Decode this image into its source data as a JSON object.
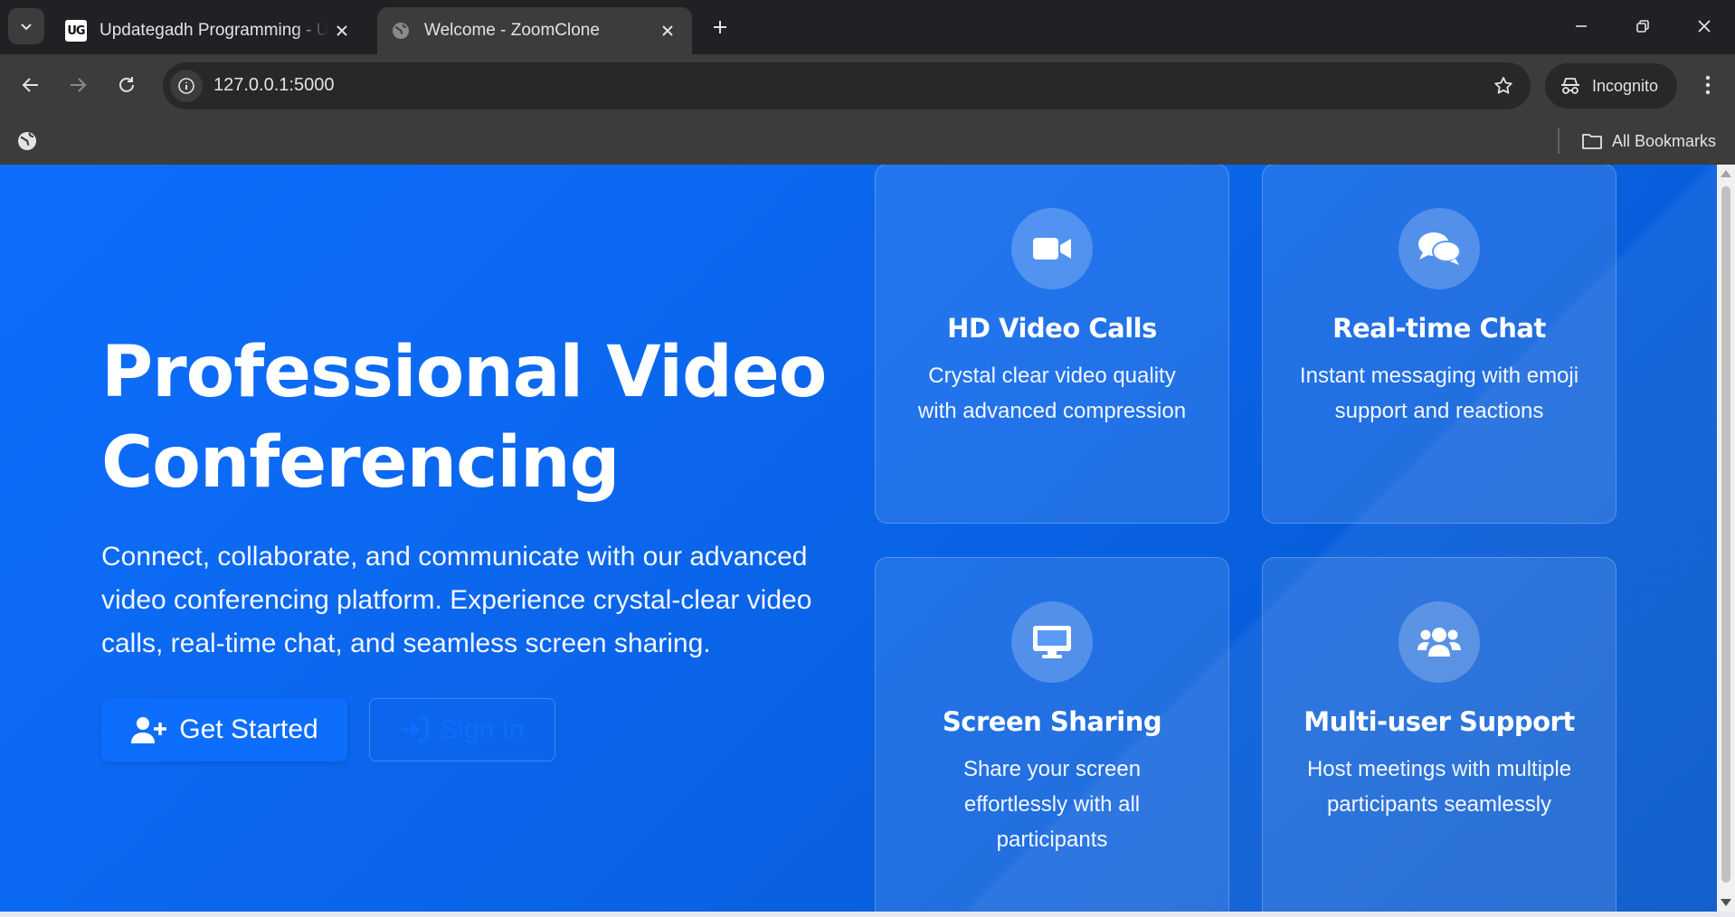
{
  "browser": {
    "tabs": [
      {
        "title": "Updategadh Programming - Up",
        "favicon": "UG",
        "active": false
      },
      {
        "title": "Welcome - ZoomClone",
        "favicon": "globe-icon",
        "active": true
      }
    ],
    "url": "127.0.0.1:5000",
    "incognito_label": "Incognito",
    "bookmarks_label": "All Bookmarks"
  },
  "hero": {
    "title": "Professional Video Conferencing",
    "lead": "Connect, collaborate, and communicate with our advanced video conferencing platform. Experience crystal-clear video calls, real-time chat, and seamless screen sharing.",
    "primary_button": "Get Started",
    "secondary_button": "Sign In"
  },
  "features": [
    {
      "icon": "video-camera-icon",
      "title": "HD Video Calls",
      "description": "Crystal clear video quality with advanced compression"
    },
    {
      "icon": "chat-bubbles-icon",
      "title": "Real-time Chat",
      "description": "Instant messaging with emoji support and reactions"
    },
    {
      "icon": "desktop-monitor-icon",
      "title": "Screen Sharing",
      "description": "Share your screen effortlessly with all participants"
    },
    {
      "icon": "users-group-icon",
      "title": "Multi-user Support",
      "description": "Host meetings with multiple participants seamlessly"
    }
  ],
  "colors": {
    "brand": "#0d6efd",
    "chrome_dark": "#202124",
    "chrome_mid": "#3c3c3c"
  }
}
